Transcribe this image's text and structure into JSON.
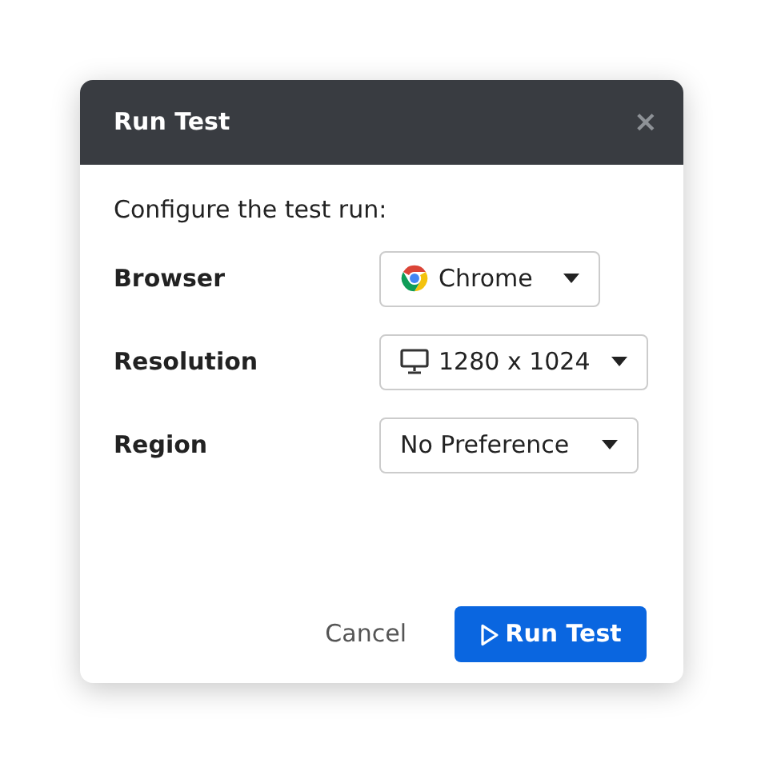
{
  "dialog": {
    "title": "Run Test",
    "close": "×",
    "intro": "Configure the test run:",
    "fields": [
      {
        "label": "Browser",
        "value": "Chrome",
        "kind": "browser"
      },
      {
        "label": "Resolution",
        "value": "1280 x 1024",
        "kind": "screen"
      },
      {
        "label": "Region",
        "value": "No Preference",
        "kind": "plain"
      }
    ],
    "buttons": [
      {
        "label": "Cancel",
        "kind": "secondary"
      },
      {
        "label": "Run Test",
        "kind": "primary"
      }
    ]
  }
}
